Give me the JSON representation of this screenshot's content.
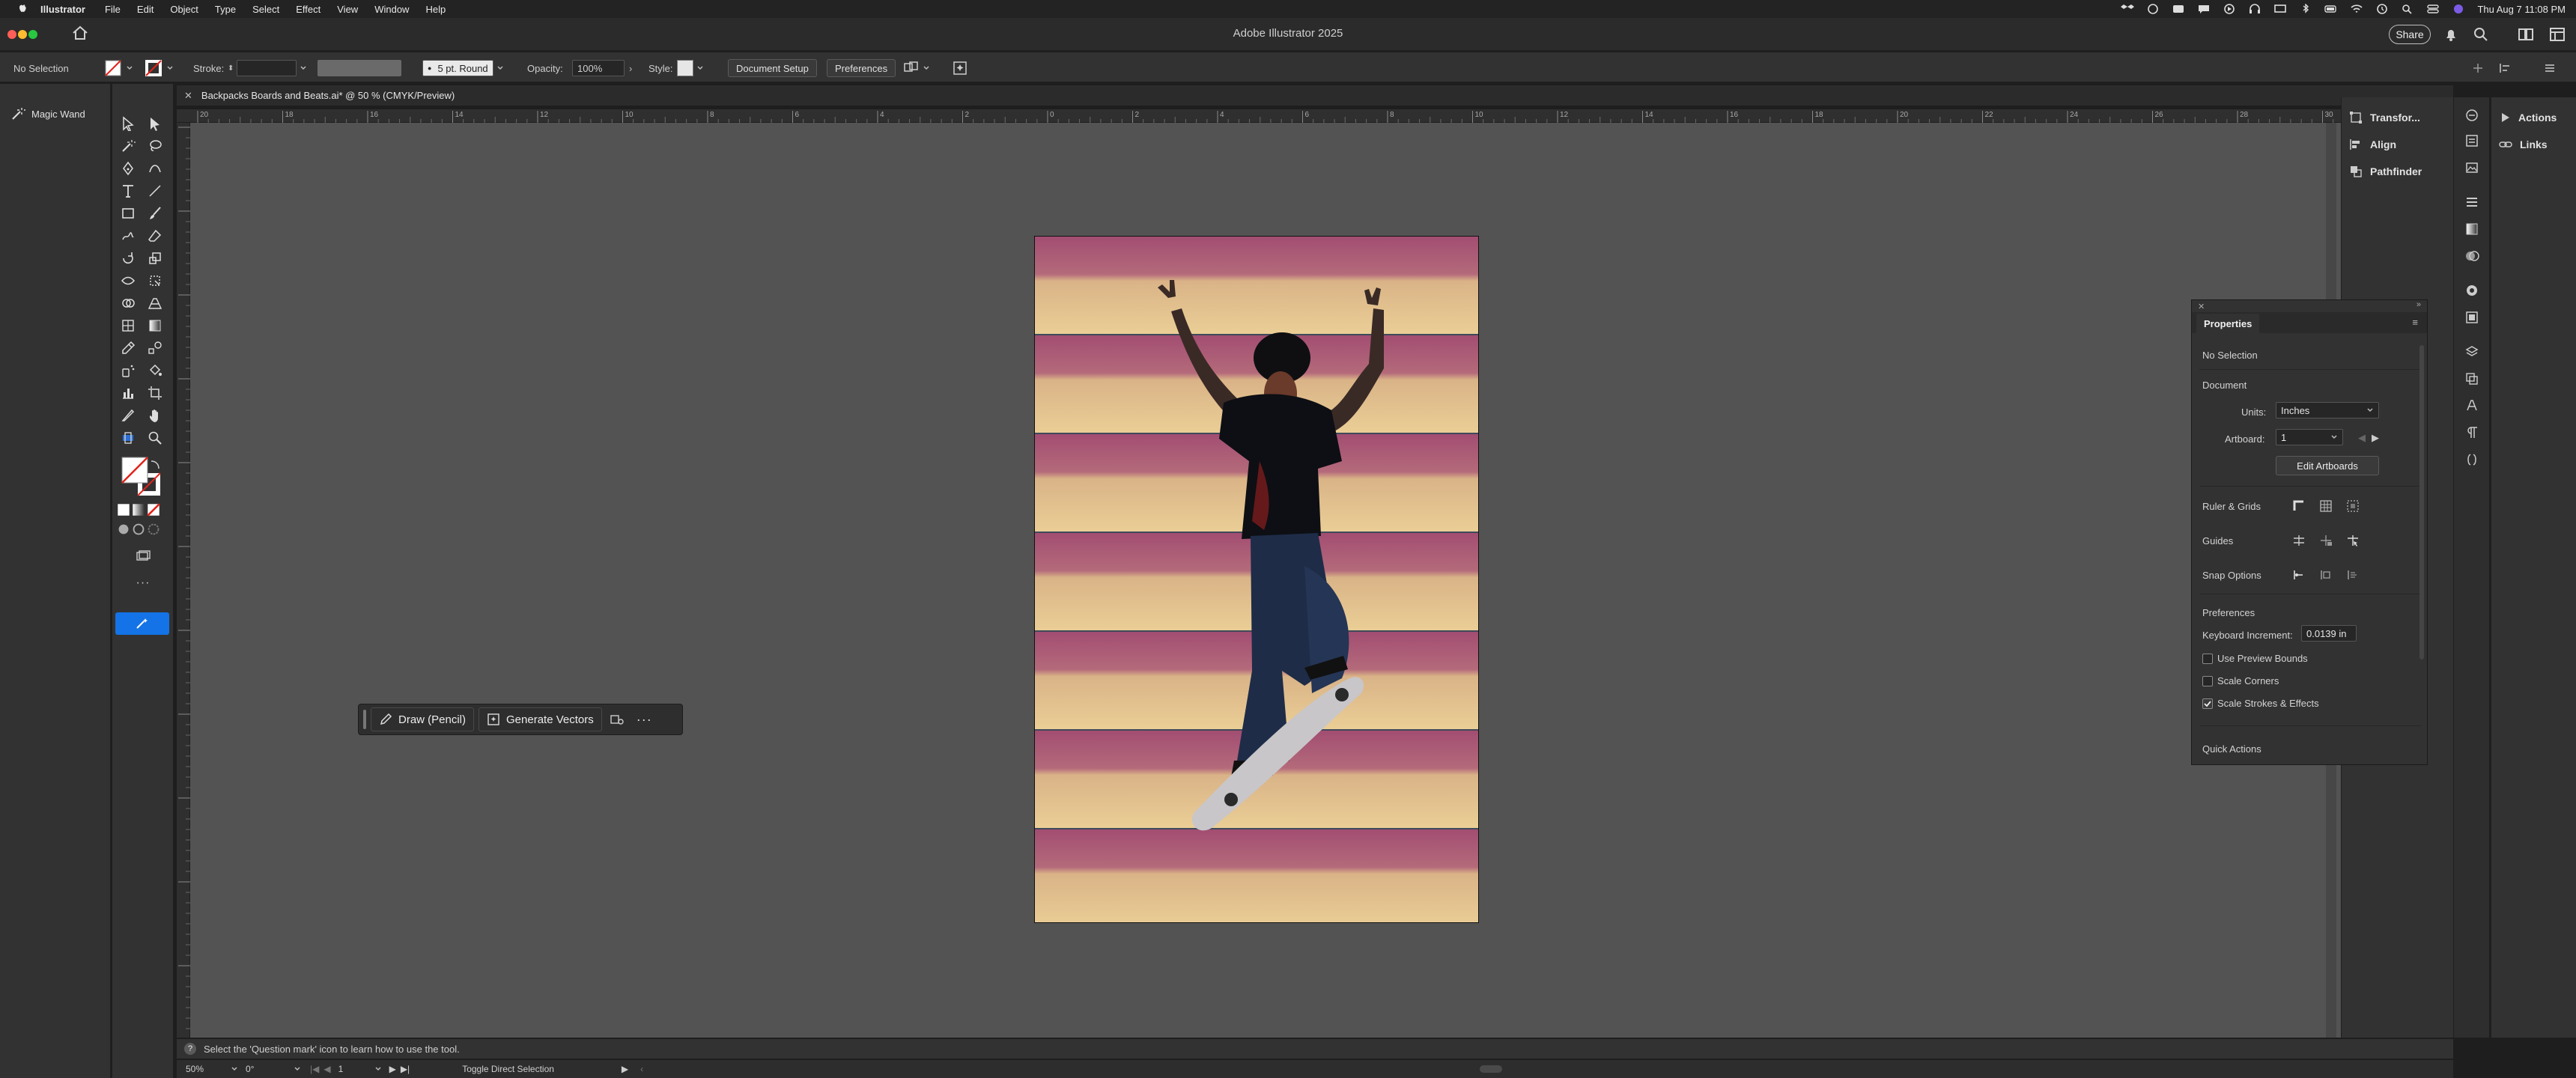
{
  "menubar": {
    "app": "Illustrator",
    "items": [
      "File",
      "Edit",
      "Object",
      "Type",
      "Select",
      "Effect",
      "View",
      "Window",
      "Help"
    ],
    "clock": "Thu Aug 7  11:08 PM"
  },
  "titlebar": {
    "title": "Adobe Illustrator 2025",
    "share": "Share"
  },
  "controlbar": {
    "selection": "No Selection",
    "stroke_label": "Stroke:",
    "brush": "5 pt. Round",
    "opacity_label": "Opacity:",
    "opacity_value": "100%",
    "style_label": "Style:",
    "document_setup": "Document Setup",
    "preferences": "Preferences"
  },
  "left_panel": {
    "magic_wand": "Magic Wand"
  },
  "document": {
    "tab_title": "Backpacks Boards and Beats.ai* @ 50 % (CMYK/Preview)"
  },
  "ruler": {
    "top_labels": [
      "20",
      "18",
      "16",
      "14",
      "12",
      "10",
      "8",
      "6",
      "4",
      "2",
      "0",
      "2",
      "4",
      "6",
      "8",
      "10",
      "12",
      "14",
      "16",
      "18",
      "20",
      "22",
      "24",
      "26",
      "28",
      "30"
    ]
  },
  "taskbar": {
    "draw": "Draw (Pencil)",
    "generate": "Generate Vectors"
  },
  "help_bar": {
    "text": "Select the 'Question mark' icon to learn how to use the tool."
  },
  "status_bar": {
    "zoom": "50%",
    "rotation": "0°",
    "artboard": "1",
    "tool_hint": "Toggle Direct Selection"
  },
  "right_dock_a": {
    "items": [
      "Transfor...",
      "Align",
      "Pathfinder"
    ]
  },
  "right_dock_b": {
    "items": [
      "Actions",
      "Links"
    ]
  },
  "properties": {
    "tab": "Properties",
    "no_selection": "No Selection",
    "document": "Document",
    "units_label": "Units:",
    "units_value": "Inches",
    "artboard_label": "Artboard:",
    "artboard_value": "1",
    "edit_artboards": "Edit Artboards",
    "ruler_grids": "Ruler & Grids",
    "guides": "Guides",
    "snap_options": "Snap Options",
    "preferences": "Preferences",
    "keyboard_increment_label": "Keyboard Increment:",
    "keyboard_increment_value": "0.0139 in",
    "use_preview_bounds": "Use Preview Bounds",
    "scale_corners": "Scale Corners",
    "scale_strokes": "Scale Strokes & Effects",
    "quick_actions": "Quick Actions",
    "checks": {
      "use_preview_bounds": false,
      "scale_corners": false,
      "scale_strokes": true
    }
  },
  "colors": {
    "accent": "#1473e6",
    "stripe_light": "#e3c48c",
    "stripe_dark": "#a0506e"
  }
}
